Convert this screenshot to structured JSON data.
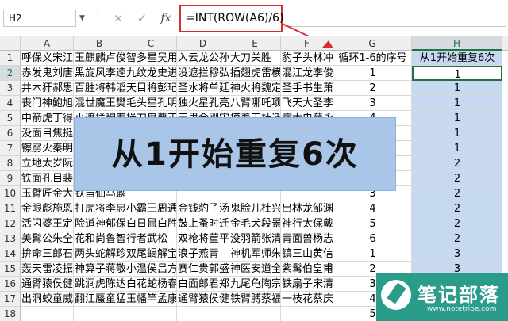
{
  "formula_bar": {
    "name_box": "H2",
    "cancel_icon": "×",
    "enter_icon": "✓",
    "fx_label": "fx",
    "formula": "=INT(ROW(A6)/6)",
    "annotation_color": "#d52f2f"
  },
  "columns": [
    "A",
    "B",
    "C",
    "D",
    "E",
    "F",
    "G",
    "H"
  ],
  "rows": [
    "1",
    "2",
    "3",
    "4",
    "5",
    "6",
    "7",
    "8",
    "9",
    "10",
    "11",
    "12",
    "13",
    "14",
    "15",
    "16",
    "17",
    "18"
  ],
  "header_g": "循环1-6的序号",
  "header_h": "从1开始重复6次",
  "text_rows": [
    [
      "呼保义宋江",
      "玉麒麟卢俊",
      "智多星吴用",
      "入云龙公孙",
      "大刀关胜",
      "豹子头林冲"
    ],
    [
      "赤发鬼刘唐",
      "黑旋风李逵",
      "九纹龙史进",
      "没遮拦穆弘",
      "插翅虎雷横",
      "混江龙李俊"
    ],
    [
      "井木犴郝思",
      "百胜将韩滔",
      "天目将彭玘",
      "圣水将单廷",
      "神火将魏定",
      "圣手书生萧"
    ],
    [
      "丧门神鲍旭",
      "混世魔王樊",
      "毛头星孔明",
      "独火星孔亮",
      "八臂哪吒项",
      "飞天大圣李"
    ],
    [
      "中箭虎丁得",
      "小遮拦穆春",
      "操刀鬼曹正",
      "云里金刚宋",
      "摸着天杜迁",
      "病大虫薛永"
    ],
    [
      "没面目焦挺",
      "石将军石勇",
      "",
      "",
      "",
      ""
    ],
    [
      "镲雳火秦明",
      "双鞭呼延灼",
      "",
      "",
      "",
      ""
    ],
    [
      "立地太岁阮",
      "短命二郎阮",
      "",
      "",
      "",
      ""
    ],
    [
      "铁面孔目裴",
      "神算子蒋敬",
      "",
      "",
      "",
      ""
    ],
    [
      "玉臂匠金大",
      "铁笛仙马麟",
      "",
      "",
      "",
      ""
    ],
    [
      "金眼彪施恩",
      "打虎将李忠",
      "小霸王周通",
      "金钱豹子汤",
      "鬼脸儿杜兴",
      "出林龙邹渊"
    ],
    [
      "活闪婆王定",
      "险道神郁保",
      "白日鼠白胜",
      "鼓上蚤时迁",
      "金毛犬段景",
      "神行太保戴"
    ],
    [
      "美髯公朱仝",
      "花和尚鲁智",
      "行者武松",
      "双枪将董平",
      "没羽箭张清",
      "青面兽杨志"
    ],
    [
      "拚命三郎石",
      "两头蛇解珍",
      "双尾蝎解宝",
      "浪子燕青",
      "神机军师朱",
      "镇三山黄信"
    ],
    [
      "轰天雷凌振",
      "神算子蒋敬",
      "小温侯吕方",
      "赛仁贵郭盛",
      "神医安道全",
      "紫髯伯皇甫"
    ],
    [
      "通臂猿侯健",
      "跳涧虎陈达",
      "白花蛇杨春",
      "白面郎君郑",
      "九尾龟陶宗",
      "铁扇子宋清"
    ],
    [
      "出洞蛟童威",
      "翻江蜃童猛",
      "玉幡竿孟康",
      "通臂猿侯健",
      "铁臂膊蔡福",
      "一枝花蔡庆"
    ]
  ],
  "col_g_values": [
    1,
    2,
    3,
    4,
    5,
    6,
    1,
    2,
    3,
    4,
    5,
    6,
    1,
    2,
    3,
    4,
    5
  ],
  "col_h_values": [
    1,
    1,
    1,
    1,
    1,
    1,
    2,
    2,
    2,
    2,
    2,
    2,
    3,
    3,
    3,
    3,
    3
  ],
  "banner": "从1开始重复6次",
  "logo": {
    "title": "笔记部落",
    "subtitle": "www.notetribe.com",
    "color": "#2c9c8a"
  },
  "colors": {
    "selection_fill": "#c7d9f0",
    "banner_fill": "#a9c5e8",
    "active_border": "#217346"
  }
}
